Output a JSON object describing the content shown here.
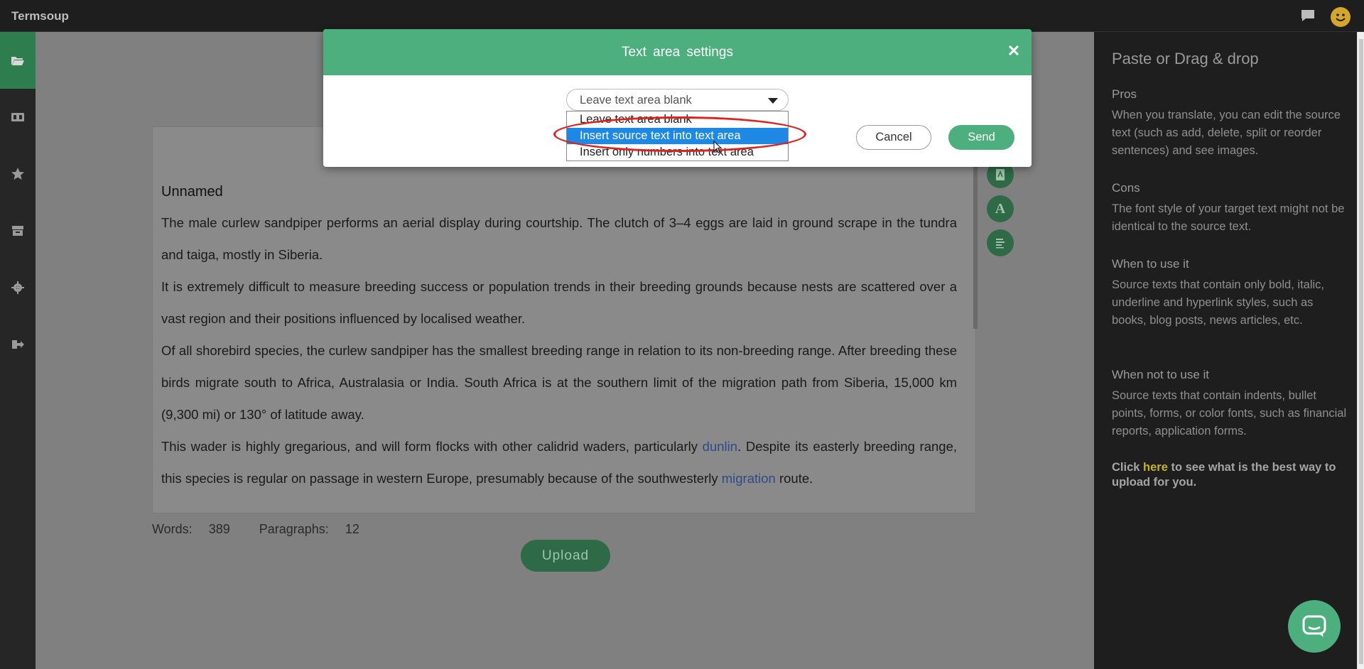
{
  "app": {
    "title": "Termsoup"
  },
  "sidebar": {
    "items": [
      {
        "icon": "folder-open-icon",
        "active": true
      },
      {
        "icon": "glossary-icon",
        "active": false
      },
      {
        "icon": "star-icon",
        "active": false
      },
      {
        "icon": "archive-icon",
        "active": false
      },
      {
        "icon": "gear-icon",
        "active": false
      },
      {
        "icon": "logout-icon",
        "active": false
      }
    ]
  },
  "document": {
    "title": "Unnamed",
    "paragraphs": [
      "The male curlew sandpiper performs an aerial display during courtship. The clutch of 3–4 eggs are laid in ground scrape in the tundra and taiga, mostly in Siberia.",
      "It is extremely difficult to measure breeding success or population trends in their breeding grounds because nests are scattered over a vast region and their positions influenced by localised weather.",
      "Of all shorebird species, the curlew sandpiper has the smallest breeding range in relation to its non-breeding range. After breeding these birds migrate south to Africa, Australasia or India. South Africa is at the southern limit of the migration path from Siberia, 15,000 km (9,300 mi) or 130° of latitude away."
    ],
    "p4_before": "This wader is highly gregarious, and will form flocks with other calidrid waders, particularly ",
    "p4_link1": "dunlin",
    "p4_middle": ". Despite its easterly breeding range, this species is regular on passage in western Europe, presumably because of the southwesterly ",
    "p4_link2": "migration",
    "p4_after": " route.",
    "words_label": "Words: ",
    "words_value": "389",
    "paragraphs_label": "Paragraphs: ",
    "paragraphs_value": "12",
    "tool_a_label": "A"
  },
  "upload_label": "Upload",
  "right_panel": {
    "heading": "Paste or Drag & drop",
    "pros_title": "Pros",
    "pros_text": "When you translate, you can edit the source text (such as add, delete, split or reorder sentences) and see images.",
    "cons_title": "Cons",
    "cons_text": "The font style of your target text might not be identical to the source text.",
    "when_title": "When to use it",
    "when_text": "Source texts that contain only bold, italic, underline and hyperlink styles, such as books, blog posts, news articles, etc.",
    "whennot_title": "When not to use it",
    "whennot_text": "Source texts that contain indents, bullet points, forms, or color fonts, such as financial reports, application forms.",
    "click_before": "Click ",
    "click_link": "here",
    "click_after": " to see what is the best way to upload for you."
  },
  "modal": {
    "title": "Text area settings",
    "select_value": "Leave text area blank",
    "options": [
      "Leave text area blank",
      "Insert source text into text area",
      "Insert only numbers into text area"
    ],
    "selected_index": 1,
    "cancel_label": "Cancel",
    "send_label": "Send"
  },
  "colors": {
    "accent": "#4caf7d",
    "highlight_ring": "#e0201a",
    "dropdown_selected": "#1e88e5"
  }
}
